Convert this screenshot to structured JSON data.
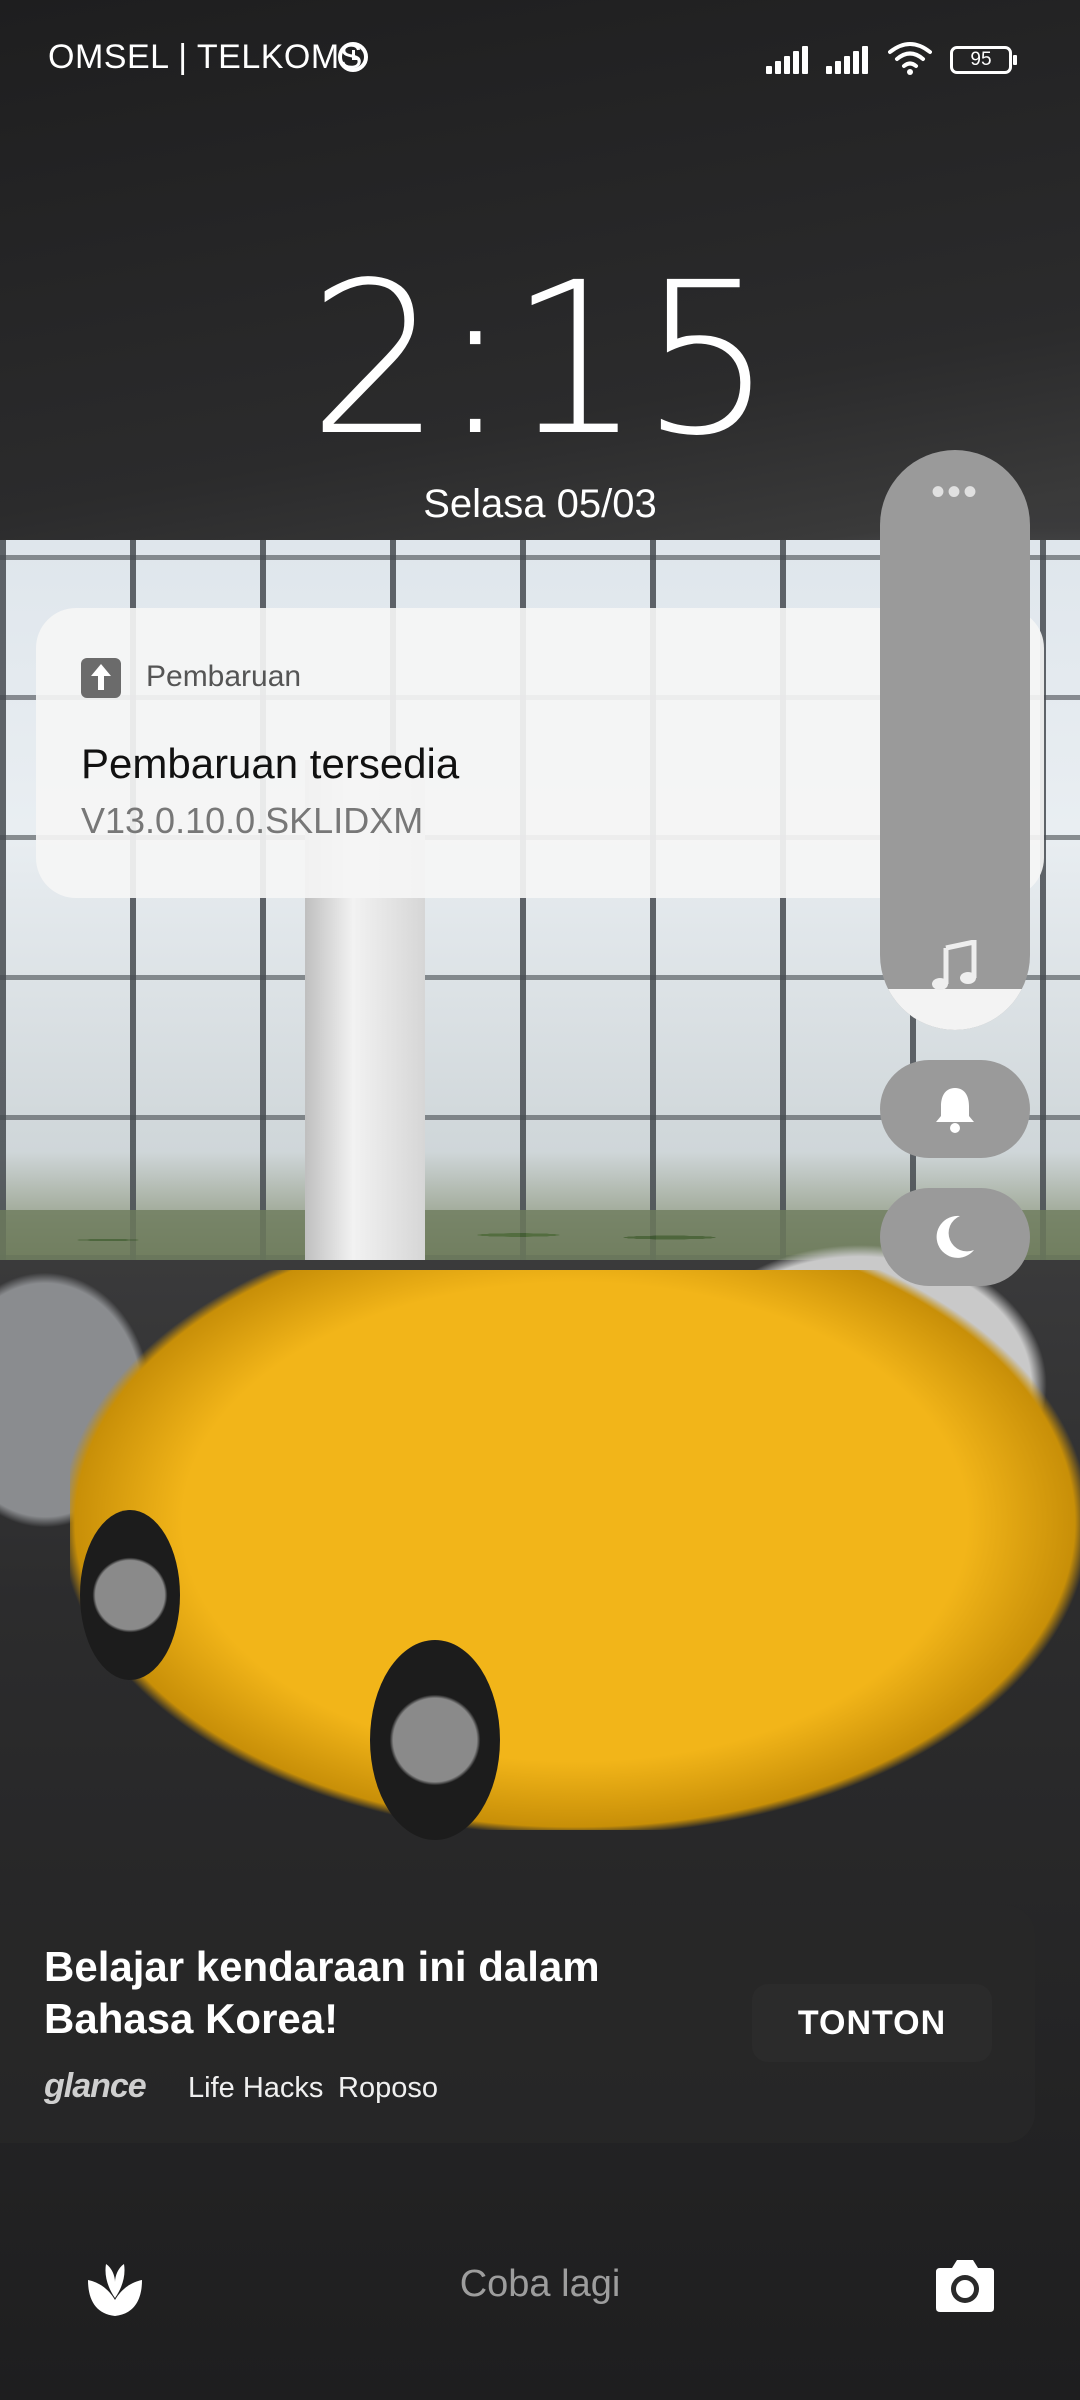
{
  "status_bar": {
    "carrier": "OMSEL | TELKOMS",
    "battery_level": "95",
    "alarm_icon": "alarm-icon",
    "wifi_icon": "wifi-icon"
  },
  "clock": {
    "time": "2:15",
    "date": "Selasa 05/03"
  },
  "notification": {
    "app_name": "Pembaruan",
    "app_icon": "upload-arrow-icon",
    "title": "Pembaruan tersedia",
    "body": "V13.0.10.0.SKLIDXM"
  },
  "volume_panel": {
    "more_icon": "more-dots-icon",
    "dots": "•••",
    "music_icon": "music-note-icon",
    "level": 0.07,
    "ringer_icon": "bell-icon",
    "dnd_icon": "moon-icon"
  },
  "glance_card": {
    "title": "Belajar kendaraan ini dalam Bahasa Korea!",
    "brand": "glance",
    "tags": [
      "Life Hacks",
      "Roposo"
    ],
    "cta": "TONTON"
  },
  "bottom_bar": {
    "hint": "Coba lagi",
    "left_icon": "glance-tulip-icon",
    "right_icon": "camera-icon"
  },
  "colors": {
    "notification_bg": "#f5f5f5",
    "volume_panel_bg": "#9a9a9a",
    "card_bg": "#282828",
    "car": "#f2b519"
  }
}
